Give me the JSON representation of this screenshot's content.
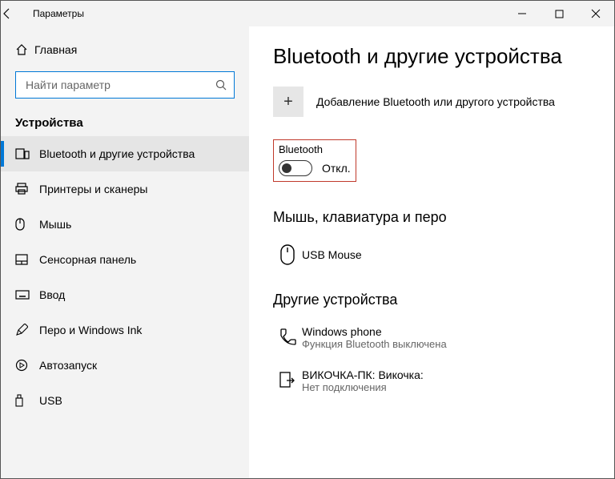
{
  "window": {
    "title": "Параметры"
  },
  "sidebar": {
    "home": "Главная",
    "search_placeholder": "Найти параметр",
    "section": "Устройства",
    "items": [
      {
        "label": "Bluetooth и другие устройства"
      },
      {
        "label": "Принтеры и сканеры"
      },
      {
        "label": "Мышь"
      },
      {
        "label": "Сенсорная панель"
      },
      {
        "label": "Ввод"
      },
      {
        "label": "Перо и Windows Ink"
      },
      {
        "label": "Автозапуск"
      },
      {
        "label": "USB"
      }
    ]
  },
  "content": {
    "title": "Bluetooth и другие устройства",
    "add_label": "Добавление Bluetooth или другого устройства",
    "bluetooth": {
      "label": "Bluetooth",
      "state": "Откл."
    },
    "section1": {
      "title": "Мышь, клавиатура и перо",
      "devices": [
        {
          "name": "USB Mouse"
        }
      ]
    },
    "section2": {
      "title": "Другие устройства",
      "devices": [
        {
          "name": "Windows phone",
          "sub": "Функция Bluetooth выключена"
        },
        {
          "name": "ВИКОЧКА-ПК: Викочка:",
          "sub": "Нет подключения"
        }
      ]
    }
  }
}
